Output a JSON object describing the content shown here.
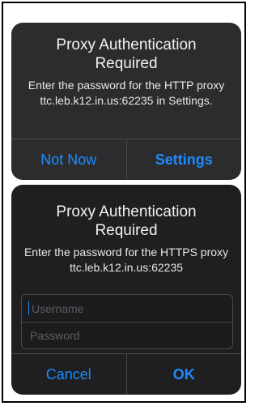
{
  "http_dialog": {
    "title": "Proxy Authentication Required",
    "message": "Enter the password for the HTTP proxy ttc.leb.k12.in.us:62235 in Settings.",
    "buttons": {
      "left": "Not Now",
      "right": "Settings"
    }
  },
  "https_dialog": {
    "title": "Proxy Authentication Required",
    "message": "Enter the password for the HTTPS proxy ttc.leb.k12.in.us:62235",
    "username_placeholder": "Username",
    "password_placeholder": "Password",
    "buttons": {
      "left": "Cancel",
      "right": "OK"
    }
  },
  "colors": {
    "accent": "#1e8bff",
    "dialog_bg": "#2c2c2e"
  }
}
